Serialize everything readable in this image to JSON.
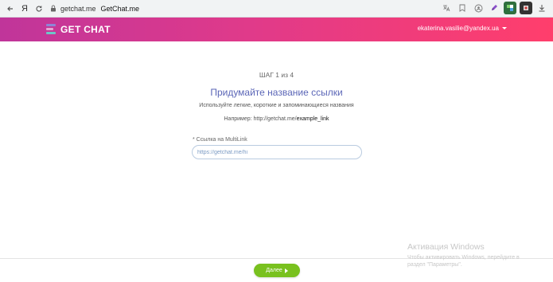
{
  "browser": {
    "url_domain": "getchat.me",
    "tab_title": "GetChat.me",
    "yandex_glyph": "Я"
  },
  "header": {
    "logo_text": "GET CHAT",
    "user_email": "ekaterina.vasilie@yandex.ua"
  },
  "main": {
    "step": "ШАГ 1 из 4",
    "title": "Придумайте название ссылки",
    "subtitle": "Используйте легкие, короткие и запоминающиеся названия",
    "example_prefix": "Например: http://getchat.me/",
    "example_value": "example_link"
  },
  "form": {
    "label": "* Ссылка на MultiLink",
    "value": "https://getchat.me/hi"
  },
  "footer": {
    "next_label": "Далее"
  },
  "windows_watermark": {
    "line1": "Активация Windows",
    "line2": "Чтобы активировать Windows, перейдите в",
    "line3": "раздел \"Параметры\"."
  },
  "colors": {
    "header_start": "#c0359a",
    "header_end": "#ff3e6c",
    "title": "#5b66b7",
    "button": "#79c11f"
  },
  "icons": [
    "back-icon",
    "yandex-icon",
    "reload-icon",
    "lock-icon",
    "translate-icon",
    "bookmark-icon",
    "password-icon",
    "pen-extension-icon",
    "extension-icon",
    "download-icon",
    "chevron-down-icon",
    "play-icon"
  ]
}
